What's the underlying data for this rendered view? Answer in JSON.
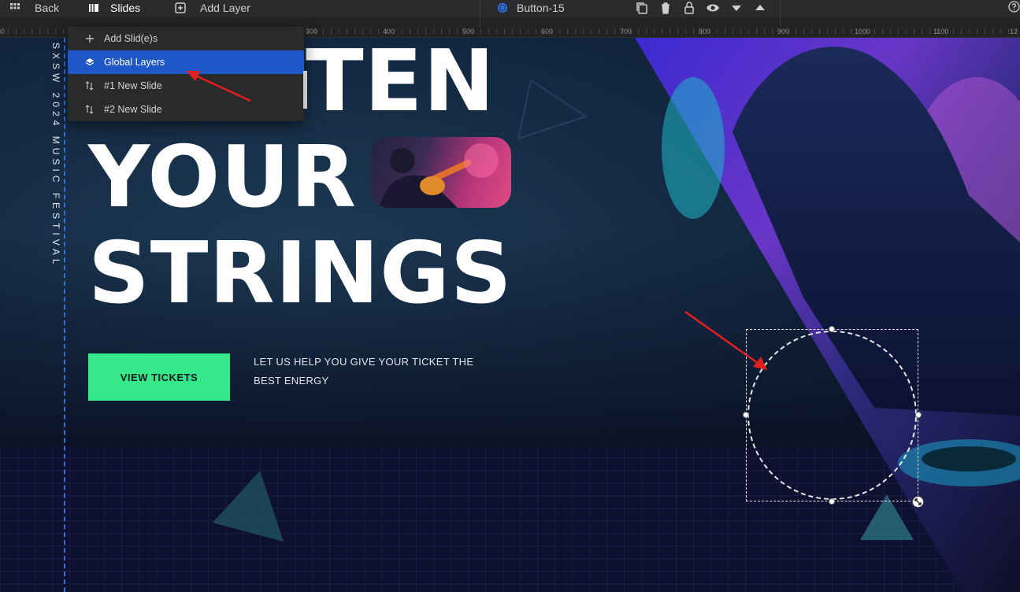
{
  "toolbar": {
    "back_label": "Back",
    "slides_label": "Slides",
    "add_layer_label": "Add Layer",
    "selected_layer": "Button-15"
  },
  "ruler": {
    "labels": [
      "0",
      "300",
      "400",
      "500",
      "600",
      "700",
      "800",
      "900",
      "1000",
      "1100",
      "12"
    ]
  },
  "dropdown": {
    "items": [
      {
        "label": "Add Slid(e)s"
      },
      {
        "label": "Global Layers"
      },
      {
        "label": "#1 New Slide"
      },
      {
        "label": "#2 New Slide"
      }
    ]
  },
  "hero": {
    "vertical_text": "SXSW 2024 MUSIC FESTIVAL",
    "headline_1": "TEN",
    "headline_2": "YOUR",
    "headline_3": "STRINGS",
    "cta_label": "VIEW TICKETS",
    "tagline": "LET US HELP YOU GIVE YOUR TICKET THE BEST ENERGY"
  },
  "colors": {
    "accent_blue": "#1f57c7",
    "cta_green": "#35e889",
    "annotation_red": "#e0201f"
  }
}
